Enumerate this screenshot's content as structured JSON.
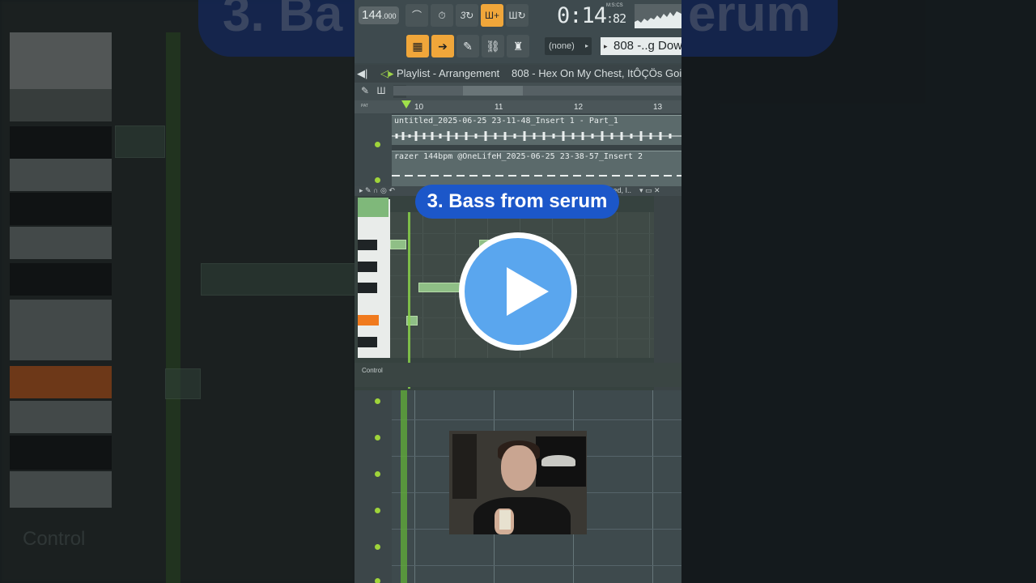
{
  "caption": "3. Bass from serum",
  "background_caption": "3. Ba",
  "background_caption_right": "erum",
  "background_control": "Control",
  "toolbar": {
    "tempo": "144",
    "tempo_decimal": ".000",
    "time": "0:14",
    "time_ms": ":82",
    "time_unit": "M:S:CS",
    "pattern_select": "(none)",
    "pattern_name": "808 -..g Down"
  },
  "playlist": {
    "title": "Playlist - Arrangement",
    "breadcrumb": "808 - Hex On My Chest, ItÔÇÖs Goin",
    "ruler": [
      "10",
      "11",
      "12",
      "13"
    ],
    "ruler_side": "PAT",
    "clips": [
      "untitled_2025-06-25 23-11-48_Insert 1 - Part_1",
      "razer 144bpm @OneLifeH_2025-06-25 23-38-57_Insert 2"
    ]
  },
  "piano_roll": {
    "header_text": "ched, I..",
    "control_label": "Control"
  },
  "colors": {
    "accent_orange": "#f0a63a",
    "caption_blue": "#1c57c9",
    "play_blue": "#5aa6ee",
    "playhead_green": "#9fe04a"
  }
}
